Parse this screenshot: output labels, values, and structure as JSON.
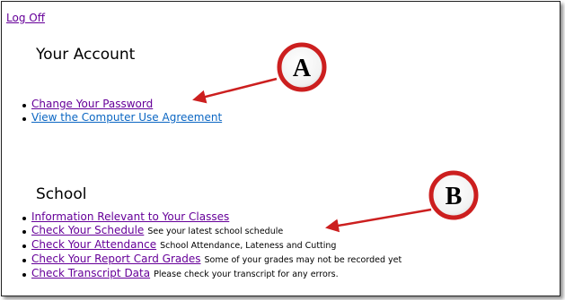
{
  "header": {
    "logoff_label": "Log Off"
  },
  "account_section": {
    "title": "Your Account",
    "links": [
      {
        "label": "Change Your Password",
        "state": "visited"
      },
      {
        "label": "View the Computer Use Agreement",
        "state": "unvisited"
      }
    ]
  },
  "school_section": {
    "title": "School",
    "links": [
      {
        "label": "Information Relevant to Your Classes",
        "desc": ""
      },
      {
        "label": "Check Your Schedule",
        "desc": "See your latest school schedule"
      },
      {
        "label": "Check Your Attendance",
        "desc": "School Attendance, Lateness and Cutting"
      },
      {
        "label": "Check Your Report Card Grades",
        "desc": "Some of your grades may not be recorded yet"
      },
      {
        "label": "Check Transcript Data",
        "desc": "Please check your transcript for any errors."
      }
    ]
  },
  "annotations": [
    {
      "letter": "A"
    },
    {
      "letter": "B"
    }
  ],
  "colors": {
    "visited_link": "#660099",
    "unvisited_link": "#0b66c3",
    "annotation_red": "#cc1f1f"
  }
}
